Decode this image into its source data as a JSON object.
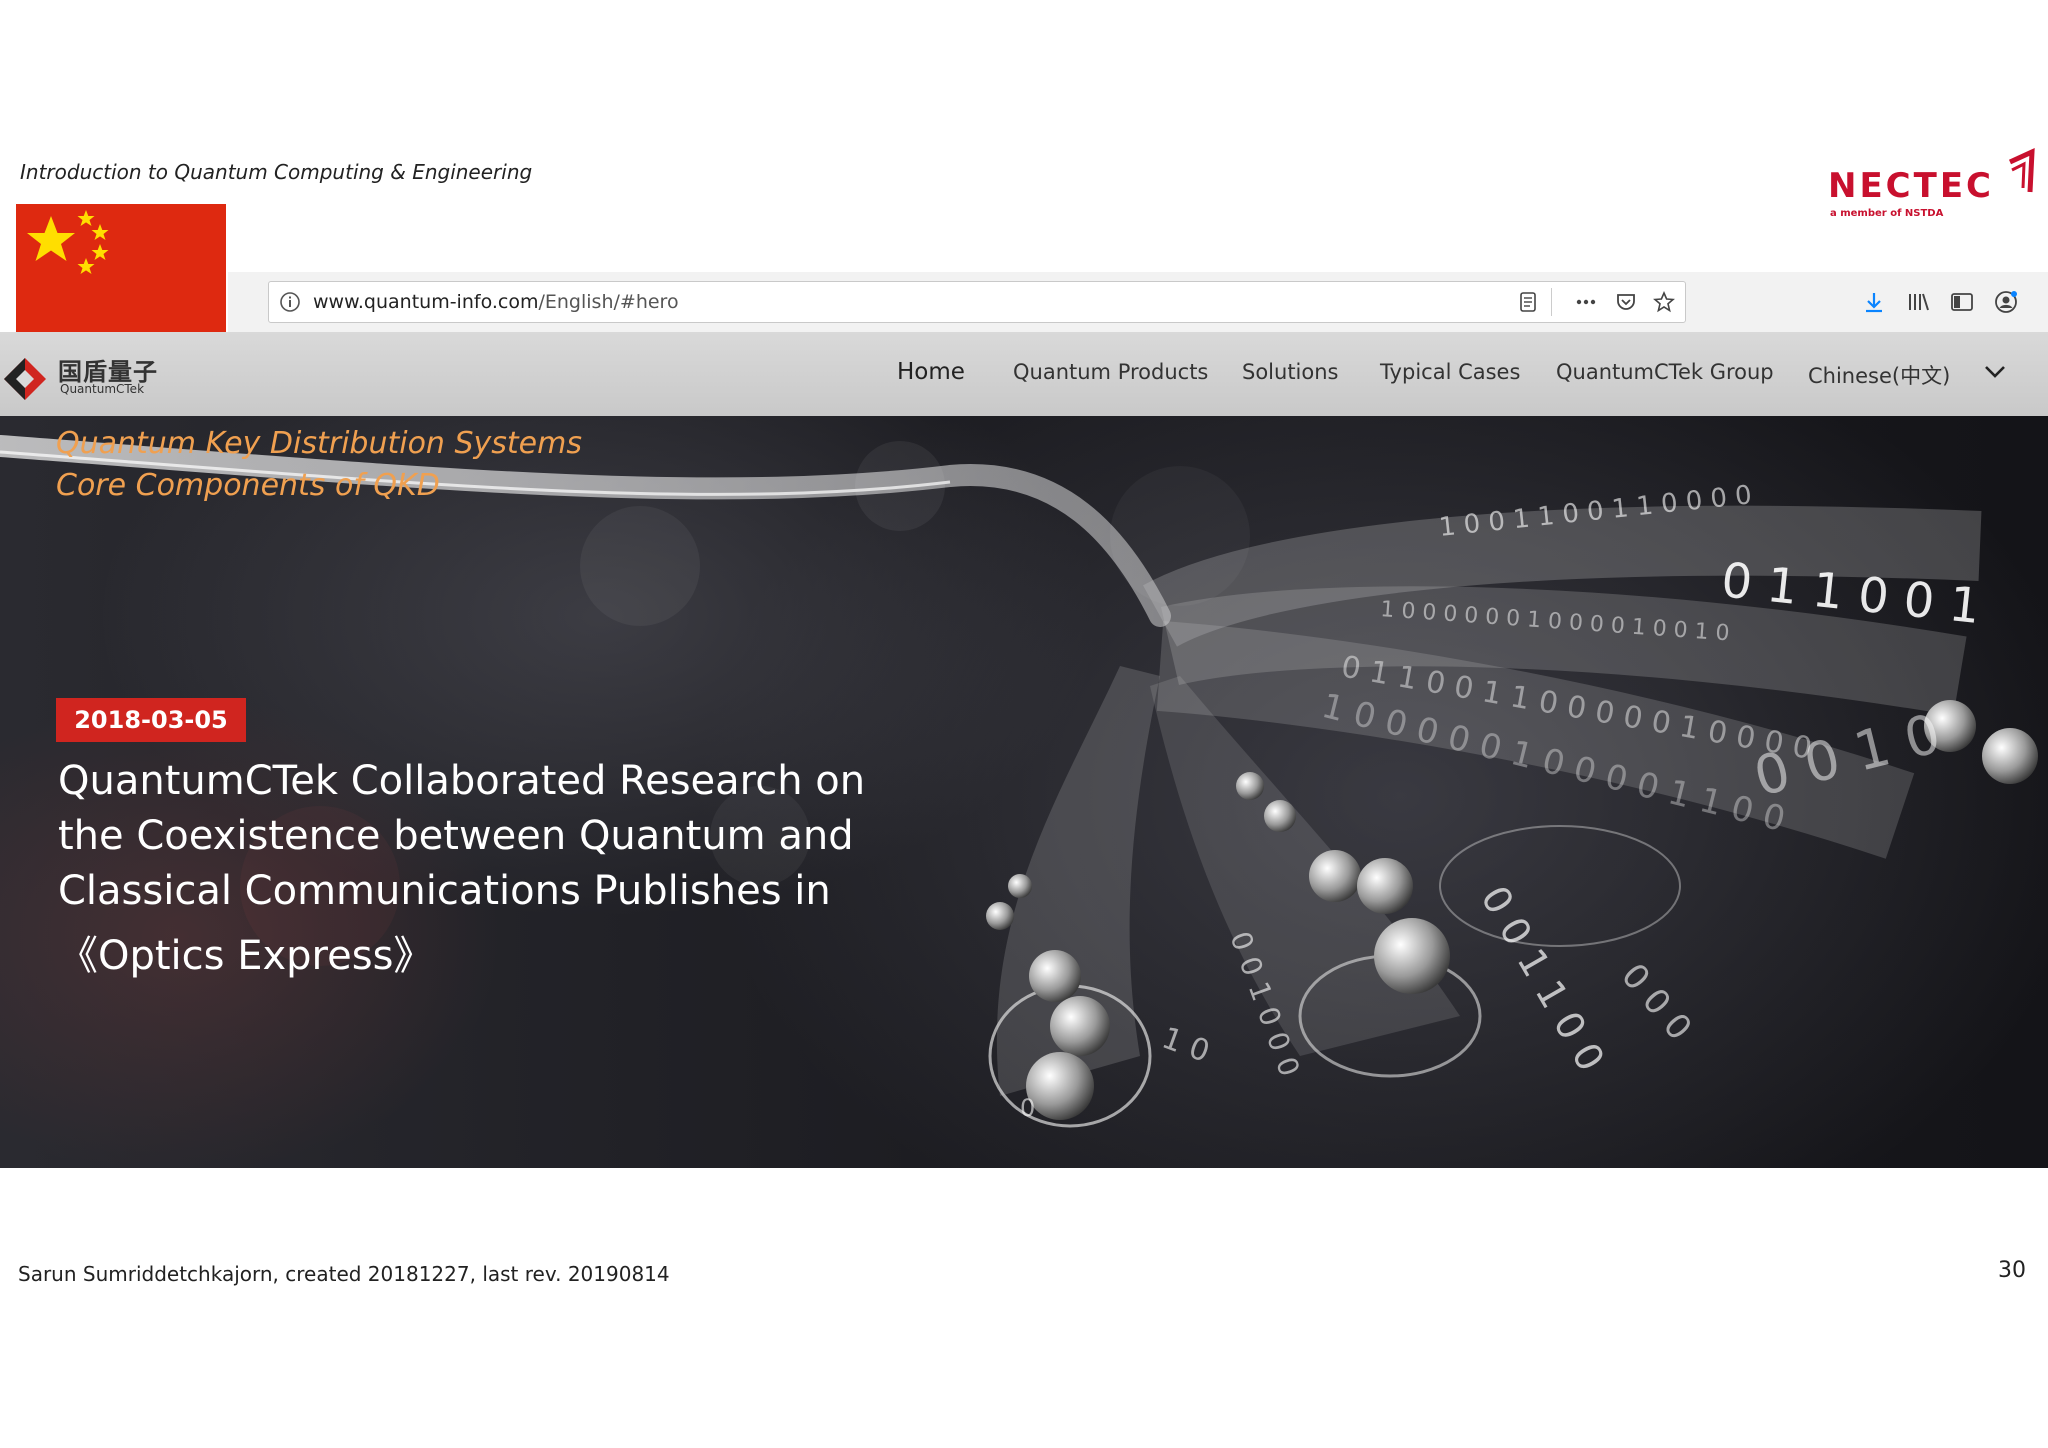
{
  "slide": {
    "title": "Introduction to Quantum Computing & Engineering",
    "footer_credit": "Sarun Sumriddetchkajorn, created 20181227, last rev. 20190814",
    "page_number": "30"
  },
  "logo": {
    "name": "NECTEC",
    "tagline": "a member of NSTDA"
  },
  "browser": {
    "url_host": "www.quantum-info.com",
    "url_path": "/English/#hero",
    "icons": [
      "info-icon",
      "reader-view-icon",
      "more-icon",
      "pocket-icon",
      "bookmark-star-icon",
      "download-icon",
      "library-icon",
      "sidebar-icon",
      "account-icon"
    ]
  },
  "site": {
    "logo_cn": "国盾量子",
    "logo_en": "QuantumCTek",
    "nav": [
      {
        "label": "Home"
      },
      {
        "label": "Quantum Products"
      },
      {
        "label": "Solutions"
      },
      {
        "label": "Typical Cases"
      },
      {
        "label": "QuantumCTek Group"
      },
      {
        "label": "Chinese(中文)"
      }
    ]
  },
  "hero": {
    "subtitle_1": "Quantum Key Distribution Systems",
    "subtitle_2": "Core Components of QKD",
    "date": "2018-03-05",
    "headline": [
      "QuantumCTek Collaborated Research on",
      "the Coexistence between Quantum and",
      "Classical Communications Publishes in",
      "《Optics Express》"
    ]
  },
  "colors": {
    "flag_red": "#de2910",
    "flag_star": "#ffde00",
    "nectec_red": "#c8102e",
    "badge_red": "#d0251f",
    "subtitle_orange": "#f0a050",
    "download_blue": "#0a84ff"
  }
}
